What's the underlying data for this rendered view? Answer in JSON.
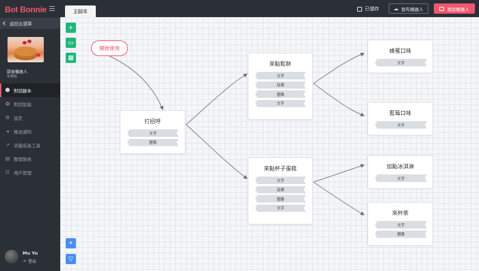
{
  "app": {
    "logo": "Bot Bonnie"
  },
  "sidebar": {
    "back_label": "返回主選單",
    "bot_name": "甜食機器人",
    "bot_plan": "免費版",
    "items": [
      {
        "label": "對話腳本",
        "icon": "robot-icon",
        "active": true
      },
      {
        "label": "對話智能",
        "icon": "brain-icon",
        "active": false
      },
      {
        "label": "設定",
        "icon": "gear-icon",
        "active": false
      },
      {
        "label": "推送通知",
        "icon": "broadcast-icon",
        "active": false
      },
      {
        "label": "流量成長工具",
        "icon": "growth-icon",
        "active": false
      },
      {
        "label": "整理報表",
        "icon": "report-icon",
        "active": false
      },
      {
        "label": "用戶管理",
        "icon": "users-icon",
        "active": false
      }
    ],
    "user": {
      "name": "Mu Yu",
      "logout_label": "登出"
    }
  },
  "topbar": {
    "tab_label": "主腳本",
    "saved_label": "已儲存",
    "publish_label": "發布機器人",
    "test_label": "測試機器人"
  },
  "canvas": {
    "start_label": "開始使用",
    "nodes": [
      {
        "id": "greet",
        "title": "打招呼",
        "chips": [
          "文字",
          "圖像"
        ]
      },
      {
        "id": "waffle",
        "title": "來點鬆餅",
        "chips": [
          "文字",
          "延遲",
          "圖像",
          "文字"
        ]
      },
      {
        "id": "cupcake",
        "title": "來點杯子蛋糕",
        "chips": [
          "文字",
          "延遲",
          "圖像",
          "文字"
        ]
      },
      {
        "id": "honey",
        "title": "蜂蜜口味",
        "chips": [
          "文字"
        ]
      },
      {
        "id": "blueberry",
        "title": "藍莓口味",
        "chips": [
          "文字"
        ]
      },
      {
        "id": "icecream",
        "title": "加點冰淇淋",
        "chips": [
          "文字"
        ]
      },
      {
        "id": "tea",
        "title": "來杯茶",
        "chips": [
          "文字",
          "圖像"
        ]
      }
    ]
  },
  "colors": {
    "brand": "#f0566e",
    "sidebar": "#2b2f36",
    "green_tool": "#1fb67a",
    "blue_tool": "#4a8df0"
  }
}
